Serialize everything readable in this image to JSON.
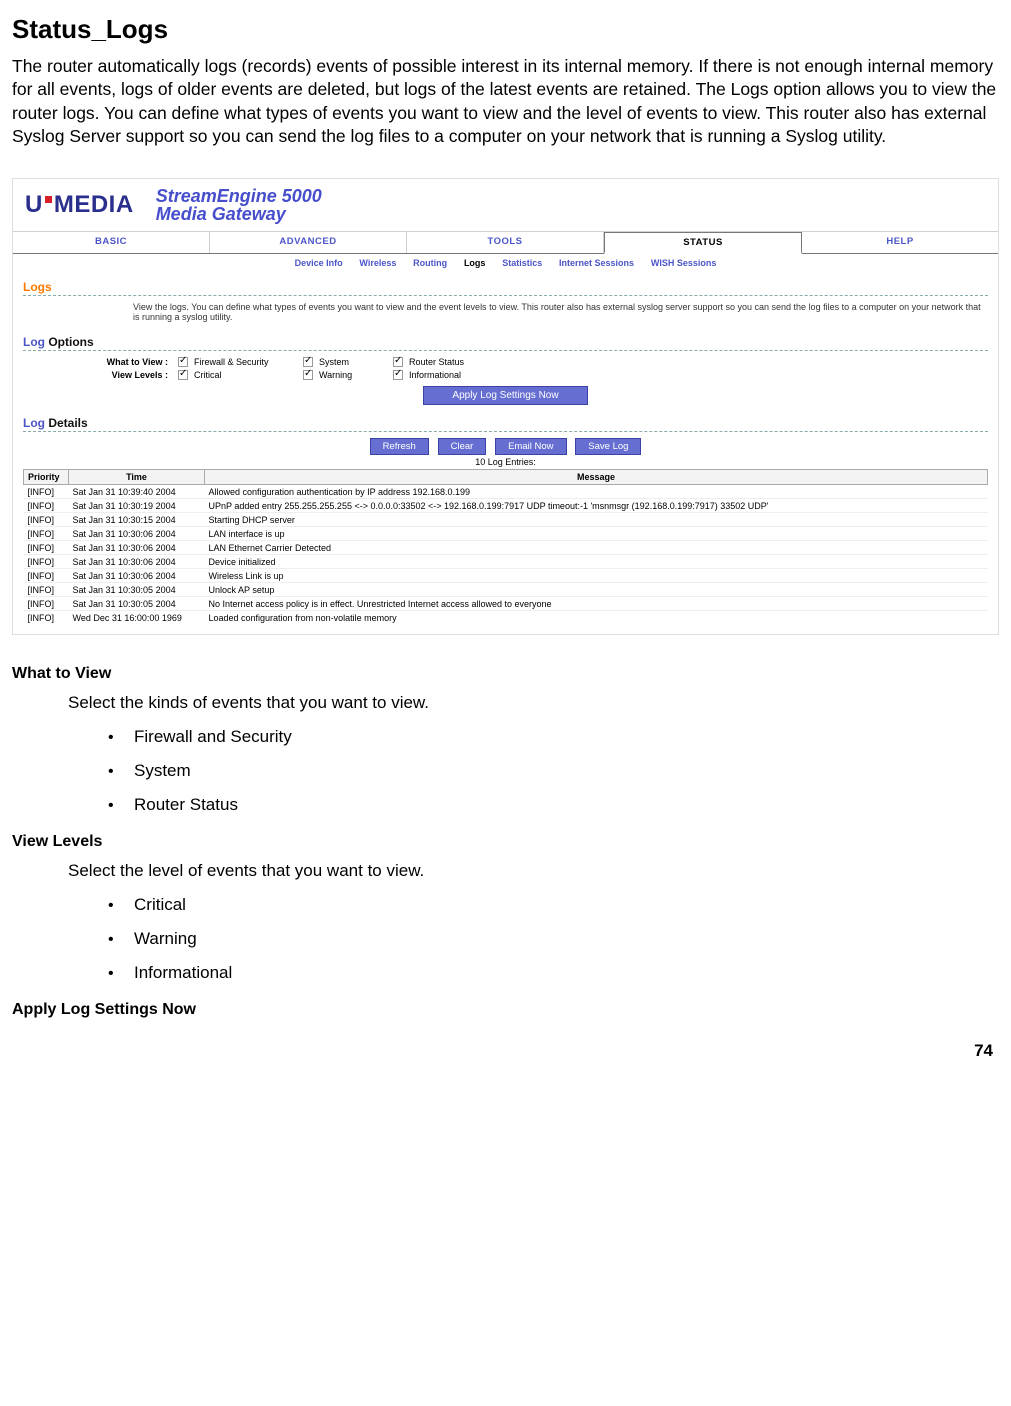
{
  "page": {
    "title": "Status_Logs",
    "intro": "The router automatically logs (records) events of possible interest in its internal memory. If there is not enough internal memory for all events, logs of older events are deleted, but logs of the latest events are retained. The Logs option allows you to view the router logs. You can define what types of events you want to view and the level of events to view. This router also has external Syslog Server support so you can send the log files to a computer on your network that is running a Syslog utility.",
    "page_number": "74"
  },
  "router_ui": {
    "brand_prefix": "U",
    "brand_suffix": "MEDIA",
    "product_line1": "StreamEngine 5000",
    "product_line2": "Media Gateway",
    "main_tabs": [
      "BASIC",
      "ADVANCED",
      "TOOLS",
      "STATUS",
      "HELP"
    ],
    "active_main_tab": "STATUS",
    "sub_tabs": [
      "Device Info",
      "Wireless",
      "Routing",
      "Logs",
      "Statistics",
      "Internet Sessions",
      "WISH Sessions"
    ],
    "active_sub_tab": "Logs",
    "section_logs": "Logs",
    "logs_desc": "View the logs. You can define what types of events you want to view and the event levels to view. This router also has external syslog server support so you can send the log files to a computer on your network that is running a syslog utility.",
    "section_options_prefix": "Log ",
    "section_options_rest": "Options",
    "what_to_view_label": "What to View :",
    "view_levels_label": "View Levels :",
    "view_options": [
      {
        "label": "Firewall & Security",
        "checked": true
      },
      {
        "label": "System",
        "checked": true
      },
      {
        "label": "Router Status",
        "checked": true
      }
    ],
    "level_options": [
      {
        "label": "Critical",
        "checked": true
      },
      {
        "label": "Warning",
        "checked": true
      },
      {
        "label": "Informational",
        "checked": true
      }
    ],
    "apply_button": "Apply Log Settings Now",
    "section_details_prefix": "Log ",
    "section_details_rest": "Details",
    "toolbar": {
      "refresh": "Refresh",
      "clear": "Clear",
      "email": "Email Now",
      "save": "Save Log"
    },
    "entries_text": "10 Log Entries:",
    "columns": {
      "priority": "Priority",
      "time": "Time",
      "message": "Message"
    },
    "rows": [
      {
        "p": "[INFO]",
        "t": "Sat Jan 31 10:39:40 2004",
        "m": "Allowed configuration authentication by IP address 192.168.0.199"
      },
      {
        "p": "[INFO]",
        "t": "Sat Jan 31 10:30:19 2004",
        "m": "UPnP added entry 255.255.255.255 <-> 0.0.0.0:33502 <-> 192.168.0.199:7917 UDP timeout:-1 'msnmsgr (192.168.0.199:7917) 33502 UDP'"
      },
      {
        "p": "[INFO]",
        "t": "Sat Jan 31 10:30:15 2004",
        "m": "Starting DHCP server"
      },
      {
        "p": "[INFO]",
        "t": "Sat Jan 31 10:30:06 2004",
        "m": "LAN interface is up"
      },
      {
        "p": "[INFO]",
        "t": "Sat Jan 31 10:30:06 2004",
        "m": "LAN Ethernet Carrier Detected"
      },
      {
        "p": "[INFO]",
        "t": "Sat Jan 31 10:30:06 2004",
        "m": "Device initialized"
      },
      {
        "p": "[INFO]",
        "t": "Sat Jan 31 10:30:06 2004",
        "m": "Wireless Link is up"
      },
      {
        "p": "[INFO]",
        "t": "Sat Jan 31 10:30:05 2004",
        "m": "Unlock AP setup"
      },
      {
        "p": "[INFO]",
        "t": "Sat Jan 31 10:30:05 2004",
        "m": "No Internet access policy is in effect. Unrestricted Internet access allowed to everyone"
      },
      {
        "p": "[INFO]",
        "t": "Wed Dec 31 16:00:00 1969",
        "m": "Loaded configuration from non-volatile memory"
      }
    ]
  },
  "definitions": {
    "d1_term": "What to View",
    "d1_text": "Select the kinds of events that you want to view.",
    "d1_items": [
      "Firewall and Security",
      "System",
      "Router Status"
    ],
    "d2_term": "View Levels",
    "d2_text": "Select the level of events that you want to view.",
    "d2_items": [
      "Critical",
      "Warning",
      "Informational"
    ],
    "d3_term": "Apply Log Settings Now"
  }
}
